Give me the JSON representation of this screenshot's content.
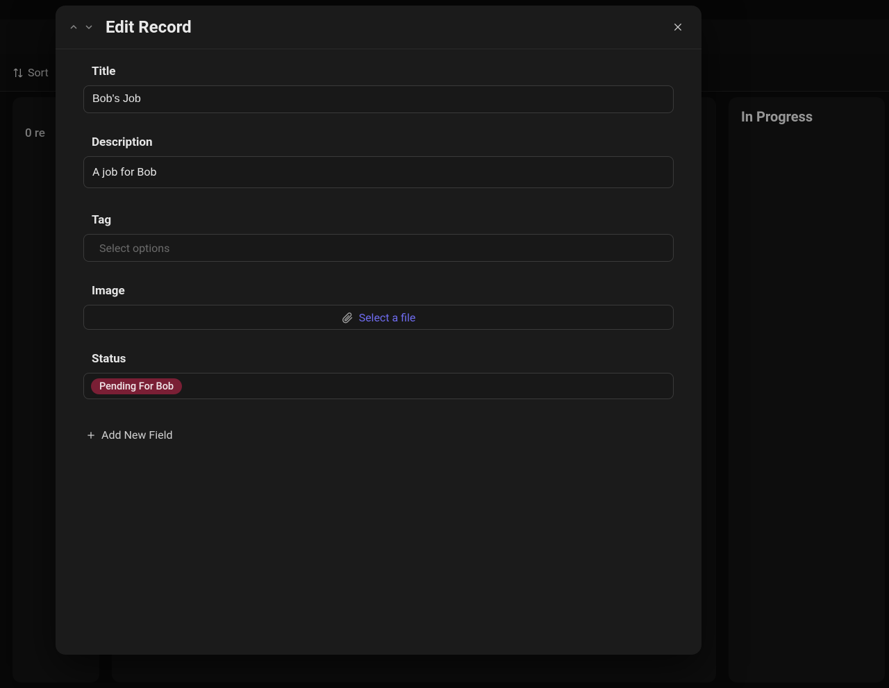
{
  "toolbar": {
    "sort_label": "Sort"
  },
  "board": {
    "records_text": "0 re",
    "columns": {
      "in_progress": "In Progress"
    }
  },
  "modal": {
    "title": "Edit Record",
    "fields": {
      "title": {
        "label": "Title",
        "value": "Bob's Job"
      },
      "description": {
        "label": "Description",
        "value": "A job for Bob"
      },
      "tag": {
        "label": "Tag",
        "placeholder": "Select options"
      },
      "image": {
        "label": "Image",
        "button_text": "Select a file"
      },
      "status": {
        "label": "Status",
        "chip": "Pending For Bob",
        "chip_color": "#7a1f35"
      }
    },
    "add_field_label": "Add New Field"
  }
}
